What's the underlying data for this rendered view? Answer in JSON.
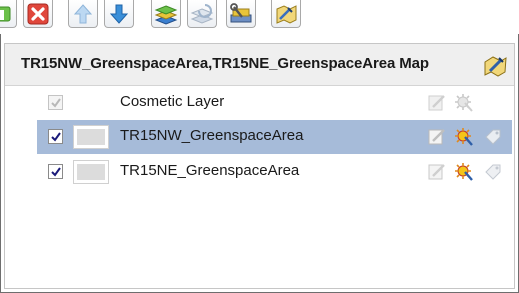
{
  "toolbar": {
    "buttons": [
      {
        "name": "add-layer-button",
        "icon": "add-layer-green-icon"
      },
      {
        "name": "remove-layer-button",
        "icon": "red-x-icon"
      },
      {
        "name": "move-up-button",
        "icon": "up-arrow-icon"
      },
      {
        "name": "move-down-button",
        "icon": "down-arrow-icon"
      },
      {
        "name": "layer-stack-button",
        "icon": "layers-icon"
      },
      {
        "name": "refresh-layers-button",
        "icon": "refresh-layers-icon"
      },
      {
        "name": "tools-button",
        "icon": "wrench-layers-icon"
      },
      {
        "name": "properties-button",
        "icon": "map-edit-icon"
      }
    ]
  },
  "panel": {
    "title": "TR15NW_GreenspaceArea,TR15NE_GreenspaceArea Map",
    "layers": [
      {
        "label": "Cosmetic Layer",
        "checked": true,
        "disabled": true,
        "selected": false,
        "has_thumbnail": false
      },
      {
        "label": "TR15NW_GreenspaceArea",
        "checked": true,
        "disabled": false,
        "selected": true,
        "has_thumbnail": true
      },
      {
        "label": "TR15NE_GreenspaceArea",
        "checked": true,
        "disabled": false,
        "selected": false,
        "has_thumbnail": true
      }
    ]
  },
  "colors": {
    "selection": "#a6bbd9",
    "header_bg": "#efefef",
    "arrow_blue": "#3a8fd9",
    "remove_red": "#d9342b"
  }
}
